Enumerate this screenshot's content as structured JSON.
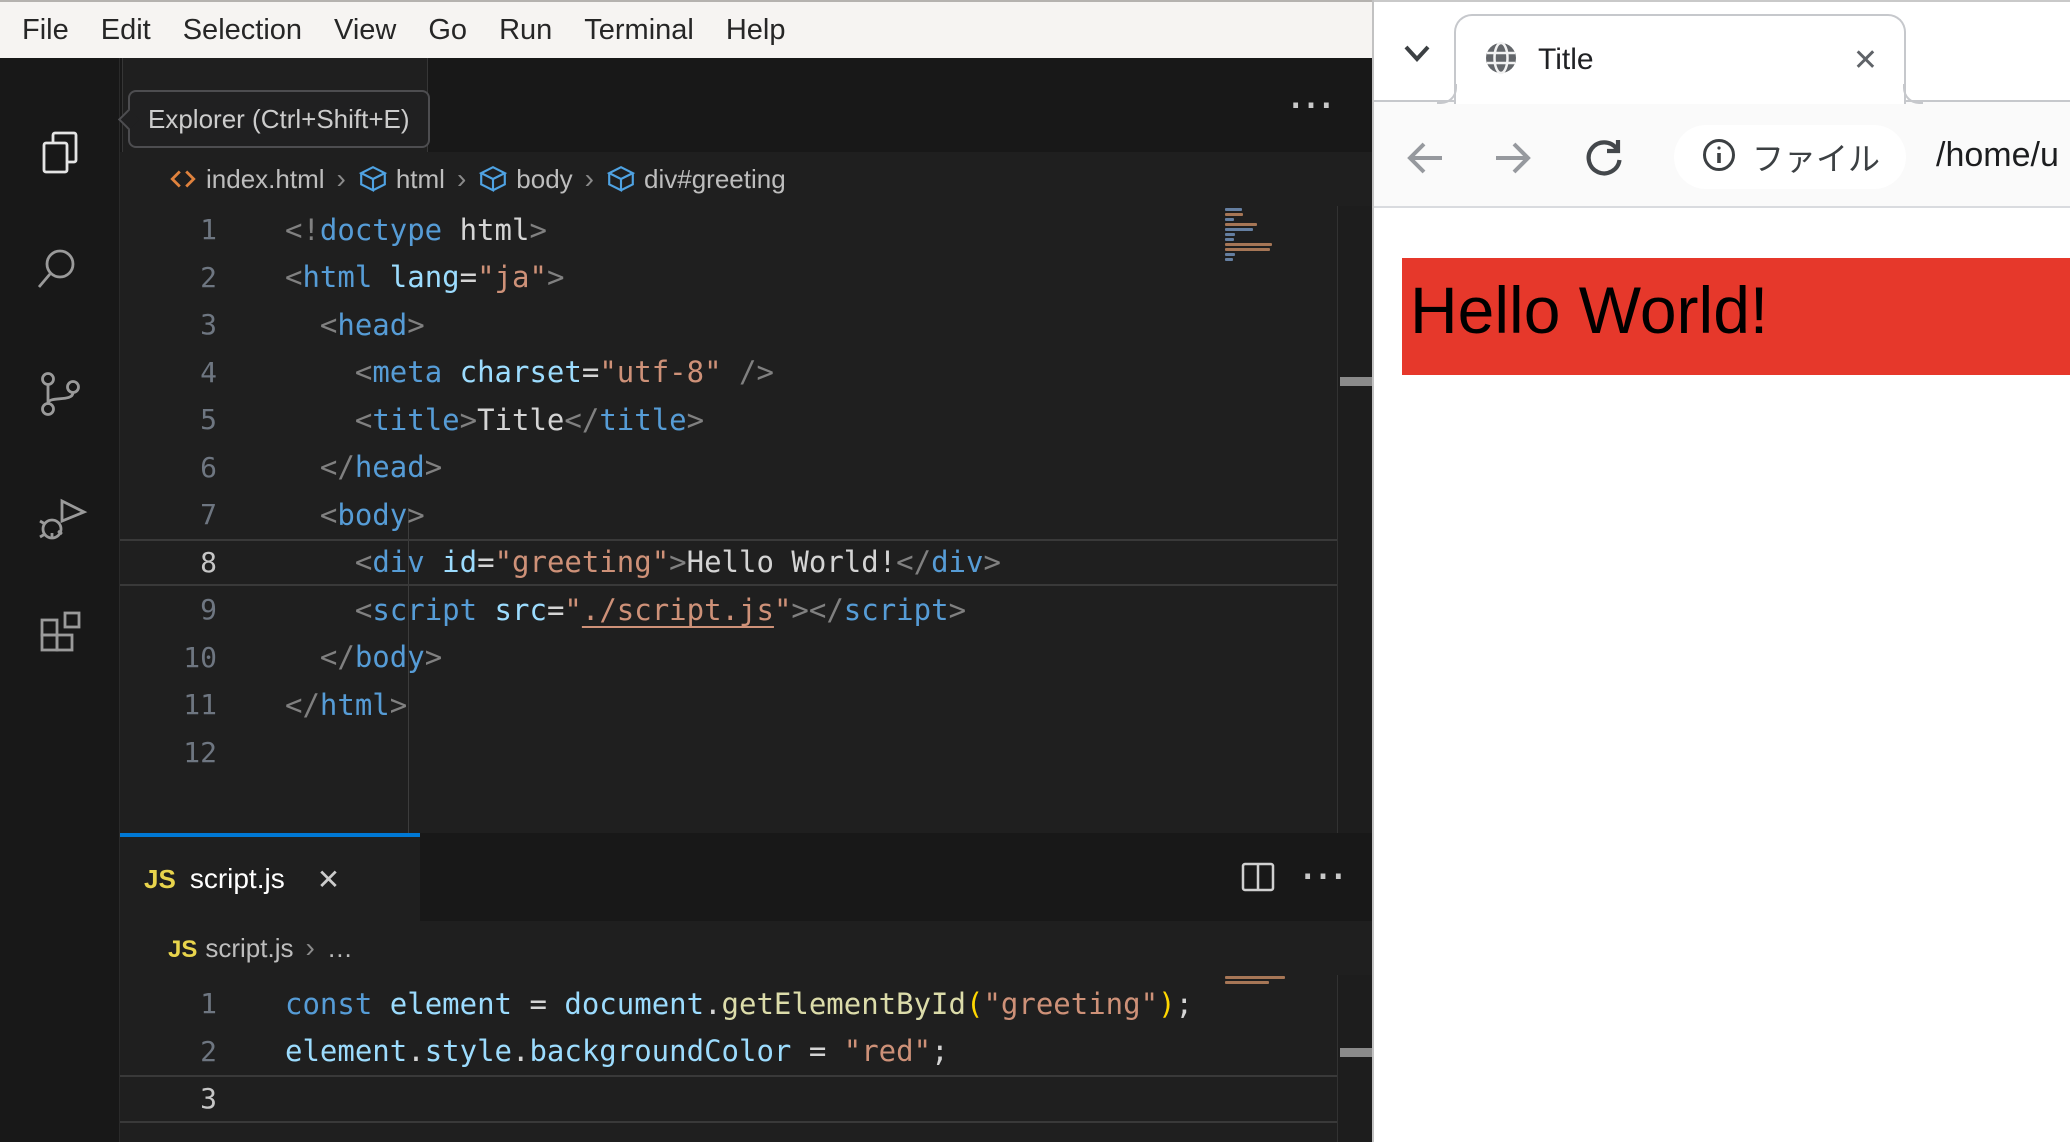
{
  "glyphs": {
    "more": "⋯",
    "close": "✕",
    "sep": "›",
    "dots": "…",
    "js_badge": "JS"
  },
  "vscode": {
    "menu": {
      "items": [
        "File",
        "Edit",
        "Selection",
        "View",
        "Go",
        "Run",
        "Terminal",
        "Help"
      ]
    },
    "activity_bar": {
      "items": [
        {
          "name": "explorer",
          "active": true
        },
        {
          "name": "search",
          "active": false
        },
        {
          "name": "source-control",
          "active": false
        },
        {
          "name": "run-debug",
          "active": false
        },
        {
          "name": "extensions",
          "active": false
        }
      ]
    },
    "tooltip": {
      "text": "Explorer (Ctrl+Shift+E)"
    },
    "editor_html": {
      "breadcrumb": [
        {
          "icon": "code",
          "label": "index.html"
        },
        {
          "icon": "cube",
          "label": "html"
        },
        {
          "icon": "cube",
          "label": "body"
        },
        {
          "icon": "cube",
          "label": "div#greeting"
        }
      ],
      "active_line": 8,
      "lines": [
        [
          [
            "p",
            "<!"
          ],
          [
            "t",
            "doctype"
          ],
          [
            "x",
            " html"
          ],
          [
            "p",
            ">"
          ]
        ],
        [
          [
            "p",
            "<"
          ],
          [
            "t",
            "html"
          ],
          [
            "x",
            " "
          ],
          [
            "a",
            "lang"
          ],
          [
            "x",
            "="
          ],
          [
            "s",
            "\"ja\""
          ],
          [
            "p",
            ">"
          ]
        ],
        [
          [
            "x",
            "  "
          ],
          [
            "p",
            "<"
          ],
          [
            "t",
            "head"
          ],
          [
            "p",
            ">"
          ]
        ],
        [
          [
            "x",
            "    "
          ],
          [
            "p",
            "<"
          ],
          [
            "t",
            "meta"
          ],
          [
            "x",
            " "
          ],
          [
            "a",
            "charset"
          ],
          [
            "x",
            "="
          ],
          [
            "s",
            "\"utf-8\""
          ],
          [
            "x",
            " "
          ],
          [
            "p",
            "/>"
          ]
        ],
        [
          [
            "x",
            "    "
          ],
          [
            "p",
            "<"
          ],
          [
            "t",
            "title"
          ],
          [
            "p",
            ">"
          ],
          [
            "x",
            "Title"
          ],
          [
            "p",
            "</"
          ],
          [
            "t",
            "title"
          ],
          [
            "p",
            ">"
          ]
        ],
        [
          [
            "x",
            "  "
          ],
          [
            "p",
            "</"
          ],
          [
            "t",
            "head"
          ],
          [
            "p",
            ">"
          ]
        ],
        [
          [
            "x",
            "  "
          ],
          [
            "p",
            "<"
          ],
          [
            "t",
            "body"
          ],
          [
            "p",
            ">"
          ]
        ],
        [
          [
            "x",
            "    "
          ],
          [
            "p",
            "<"
          ],
          [
            "t",
            "div"
          ],
          [
            "x",
            " "
          ],
          [
            "a",
            "id"
          ],
          [
            "x",
            "="
          ],
          [
            "s",
            "\"greeting\""
          ],
          [
            "p",
            ">"
          ],
          [
            "x",
            "Hello World!"
          ],
          [
            "p",
            "</"
          ],
          [
            "t",
            "div"
          ],
          [
            "p",
            ">"
          ]
        ],
        [
          [
            "x",
            "    "
          ],
          [
            "p",
            "<"
          ],
          [
            "t",
            "script"
          ],
          [
            "x",
            " "
          ],
          [
            "a",
            "src"
          ],
          [
            "x",
            "="
          ],
          [
            "s",
            "\""
          ],
          [
            "l",
            "./script.js"
          ],
          [
            "s",
            "\""
          ],
          [
            "p",
            ">"
          ],
          [
            "p",
            "</"
          ],
          [
            "t",
            "script"
          ],
          [
            "p",
            ">"
          ]
        ],
        [
          [
            "x",
            "  "
          ],
          [
            "p",
            "</"
          ],
          [
            "t",
            "body"
          ],
          [
            "p",
            ">"
          ]
        ],
        [
          [
            "p",
            "</"
          ],
          [
            "t",
            "html"
          ],
          [
            "p",
            ">"
          ]
        ],
        []
      ]
    },
    "editor_js": {
      "tab_label": "script.js",
      "breadcrumb": [
        {
          "icon": "js",
          "label": "script.js"
        },
        {
          "icon": null,
          "label": "…"
        }
      ],
      "active_line": 3,
      "lines": [
        [
          [
            "k",
            "const"
          ],
          [
            "x",
            " "
          ],
          [
            "v",
            "element"
          ],
          [
            "x",
            " = "
          ],
          [
            "v",
            "document"
          ],
          [
            "x",
            "."
          ],
          [
            "f",
            "getElementById"
          ],
          [
            "g",
            "("
          ],
          [
            "s",
            "\"greeting\""
          ],
          [
            "g",
            ")"
          ],
          [
            "x",
            ";"
          ]
        ],
        [
          [
            "v",
            "element"
          ],
          [
            "x",
            "."
          ],
          [
            "v",
            "style"
          ],
          [
            "x",
            "."
          ],
          [
            "v",
            "backgroundColor"
          ],
          [
            "x",
            " = "
          ],
          [
            "s",
            "\"red\""
          ],
          [
            "x",
            ";"
          ]
        ],
        []
      ]
    }
  },
  "browser": {
    "tab": {
      "title": "Title"
    },
    "toolbar": {
      "chip_label": "ファイル",
      "url": "/home/u"
    },
    "page": {
      "heading": "Hello World!",
      "background": "#e6382b"
    }
  },
  "colors": {
    "accent_blue": "#0078d4",
    "page_red": "#e6382b",
    "tag": "#569cd6",
    "attribute": "#9cdcfe",
    "string": "#ce9178",
    "function": "#dcdcaa",
    "bracket_gold": "#ffd700"
  }
}
